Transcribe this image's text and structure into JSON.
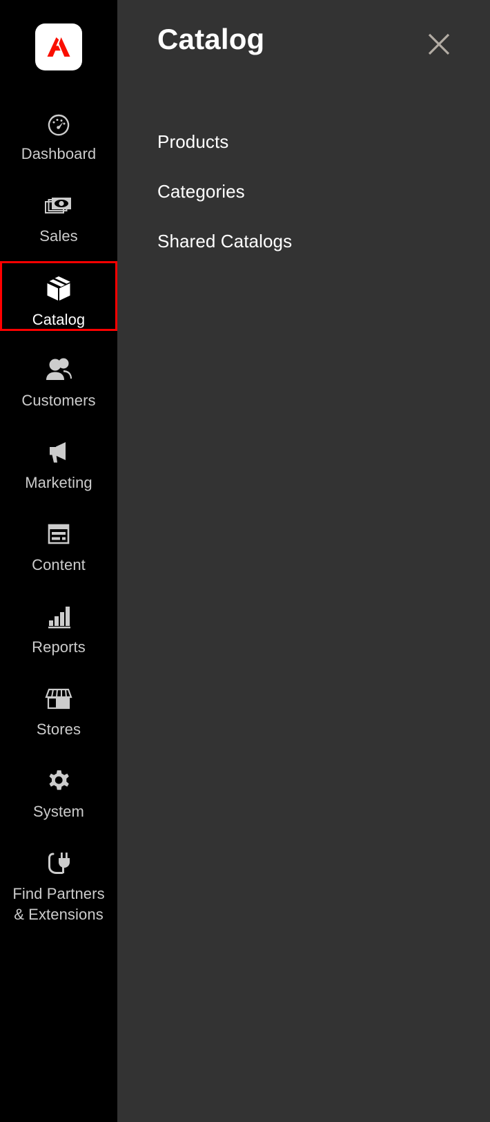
{
  "app": {
    "logo_icon": "adobe-logo-icon",
    "logo_bg": "#ffffff",
    "logo_fg": "#fa0f00",
    "sidebar_bg": "#000000",
    "panel_bg": "#333333",
    "active_outline_color": "#ff0000",
    "label_color": "#cccccc",
    "active_label_color": "#ffffff"
  },
  "sidebar": {
    "items": [
      {
        "label": "Dashboard",
        "icon": "dashboard-gauge-icon",
        "active": false
      },
      {
        "label": "Sales",
        "icon": "money-stack-icon",
        "active": false
      },
      {
        "label": "Catalog",
        "icon": "package-box-icon",
        "active": true
      },
      {
        "label": "Customers",
        "icon": "users-icon",
        "active": false
      },
      {
        "label": "Marketing",
        "icon": "megaphone-icon",
        "active": false
      },
      {
        "label": "Content",
        "icon": "content-page-icon",
        "active": false
      },
      {
        "label": "Reports",
        "icon": "bar-chart-icon",
        "active": false
      },
      {
        "label": "Stores",
        "icon": "storefront-icon",
        "active": false
      },
      {
        "label": "System",
        "icon": "gear-icon",
        "active": false
      },
      {
        "label": "Find Partners\n& Extensions",
        "icon": "plug-icon",
        "active": false
      }
    ]
  },
  "panel": {
    "title": "Catalog",
    "close_icon": "close-x-icon",
    "menu": [
      {
        "label": "Products"
      },
      {
        "label": "Categories"
      },
      {
        "label": "Shared Catalogs"
      }
    ]
  }
}
